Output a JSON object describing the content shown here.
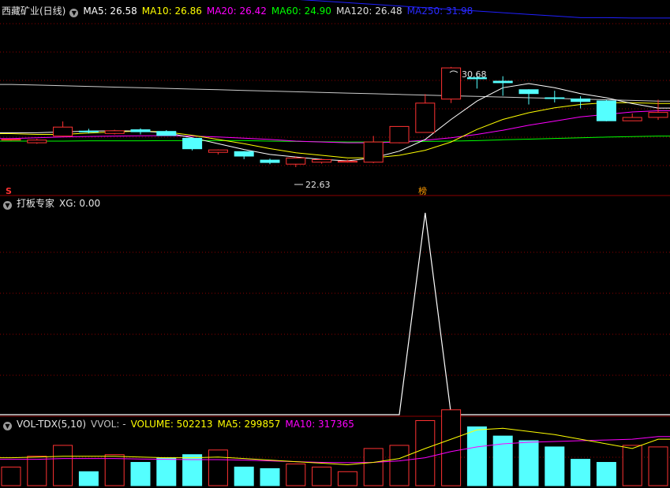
{
  "colors": {
    "up": "#ff3232",
    "down": "#54ffff",
    "ma5": "#ffffff",
    "ma10": "#ffff00",
    "ma20": "#ff00ff",
    "ma60": "#00ff00",
    "ma120": "#cccccc",
    "ma250": "#2020ff",
    "grid": "#8b0000",
    "divider": "#8b0000"
  },
  "main_header": {
    "stock_title": "西藏矿业(日线)",
    "items": [
      {
        "label": "MA5: 26.58",
        "color": "#ffffff"
      },
      {
        "label": "MA10: 26.86",
        "color": "#ffff00"
      },
      {
        "label": "MA20: 26.42",
        "color": "#ff00ff"
      },
      {
        "label": "MA60: 24.90",
        "color": "#00ff00"
      },
      {
        "label": "MA120: 26.48",
        "color": "#dddddd"
      },
      {
        "label": "MA250: 31.98",
        "color": "#2a2aff"
      }
    ]
  },
  "indicator_header": {
    "title": "打板专家",
    "value": "XG: 0.00"
  },
  "volume_header": {
    "title": "VOL-TDX(5,10)",
    "items": [
      {
        "label": "VVOL: -",
        "color": "#c0c0c0"
      },
      {
        "label": "VOLUME: 502213",
        "color": "#ffff00"
      },
      {
        "label": "MA5: 299857",
        "color": "#ffff00"
      },
      {
        "label": "MA10: 317365",
        "color": "#ff00ff"
      }
    ]
  },
  "annotations": {
    "high_label": "30.68",
    "low_label": "22.63",
    "s_marker": "S",
    "rank_marker": "榜"
  },
  "chart_data": [
    {
      "type": "candlestick",
      "title": "西藏矿业(日线)",
      "y_range": [
        22.0,
        31.0
      ],
      "candles": [
        {
          "o": 24.68,
          "c": 24.71,
          "h": 24.74,
          "l": 24.63
        },
        {
          "o": 24.5,
          "c": 24.66,
          "h": 24.74,
          "l": 24.44
        },
        {
          "o": 24.9,
          "c": 25.44,
          "h": 25.78,
          "l": 24.87
        },
        {
          "o": 25.2,
          "c": 25.16,
          "h": 25.34,
          "l": 25.06
        },
        {
          "o": 25.06,
          "c": 25.22,
          "h": 25.28,
          "l": 25.0
        },
        {
          "o": 25.28,
          "c": 25.16,
          "h": 25.37,
          "l": 25.0
        },
        {
          "o": 25.18,
          "c": 24.94,
          "h": 25.26,
          "l": 24.94
        },
        {
          "o": 24.77,
          "c": 24.14,
          "h": 24.77,
          "l": 24.04
        },
        {
          "o": 23.93,
          "c": 24.07,
          "h": 24.1,
          "l": 23.8
        },
        {
          "o": 23.97,
          "c": 23.7,
          "h": 24.0,
          "l": 23.52
        },
        {
          "o": 23.46,
          "c": 23.32,
          "h": 23.55,
          "l": 23.22
        },
        {
          "o": 23.22,
          "c": 23.59,
          "h": 23.69,
          "l": 23.04
        },
        {
          "o": 23.34,
          "c": 23.49,
          "h": 23.55,
          "l": 23.25
        },
        {
          "o": 23.34,
          "c": 23.4,
          "h": 23.49,
          "l": 23.31
        },
        {
          "o": 23.34,
          "c": 24.55,
          "h": 24.91,
          "l": 23.28
        },
        {
          "o": 24.5,
          "c": 25.48,
          "h": 25.48,
          "l": 24.47
        },
        {
          "o": 25.12,
          "c": 26.88,
          "h": 27.42,
          "l": 25.1
        },
        {
          "o": 27.12,
          "c": 28.99,
          "h": 29.05,
          "l": 26.88
        },
        {
          "o": 28.4,
          "c": 28.34,
          "h": 28.65,
          "l": 27.75
        },
        {
          "o": 28.19,
          "c": 28.1,
          "h": 28.49,
          "l": 27.32
        },
        {
          "o": 27.68,
          "c": 27.45,
          "h": 27.71,
          "l": 26.8
        },
        {
          "o": 27.2,
          "c": 27.17,
          "h": 27.62,
          "l": 26.92
        },
        {
          "o": 27.13,
          "c": 26.98,
          "h": 27.29,
          "l": 26.56
        },
        {
          "o": 27.01,
          "c": 25.82,
          "h": 27.08,
          "l": 25.79
        },
        {
          "o": 25.82,
          "c": 26.02,
          "h": 26.26,
          "l": 25.82
        },
        {
          "o": 26.02,
          "c": 26.32,
          "h": 27.09,
          "l": 25.87
        }
      ],
      "ma5": [
        25.1,
        25.1,
        25.15,
        25.2,
        25.22,
        25.2,
        25.1,
        24.8,
        24.45,
        24.1,
        23.8,
        23.65,
        23.5,
        23.42,
        23.6,
        24.0,
        24.7,
        25.9,
        27.0,
        27.8,
        28.05,
        27.8,
        27.45,
        27.2,
        26.85,
        26.58
      ],
      "ma10": [
        25.05,
        25.0,
        25.0,
        25.08,
        25.15,
        25.2,
        25.15,
        24.95,
        24.7,
        24.45,
        24.15,
        23.9,
        23.75,
        23.6,
        23.6,
        23.75,
        24.05,
        24.55,
        25.3,
        25.9,
        26.3,
        26.6,
        26.8,
        26.9,
        26.9,
        26.86
      ],
      "ma20": [
        24.75,
        24.8,
        24.85,
        24.88,
        24.9,
        24.92,
        24.93,
        24.9,
        24.85,
        24.78,
        24.7,
        24.6,
        24.55,
        24.5,
        24.5,
        24.55,
        24.65,
        24.8,
        25.0,
        25.25,
        25.55,
        25.8,
        26.05,
        26.2,
        26.35,
        26.42
      ],
      "ma60": [
        24.6,
        24.6,
        24.6,
        24.62,
        24.62,
        24.62,
        24.63,
        24.63,
        24.63,
        24.63,
        24.6,
        24.58,
        24.56,
        24.55,
        24.55,
        24.56,
        24.58,
        24.6,
        24.63,
        24.68,
        24.72,
        24.76,
        24.8,
        24.84,
        24.87,
        24.9
      ],
      "ma120": [
        28.0,
        27.96,
        27.92,
        27.88,
        27.84,
        27.8,
        27.76,
        27.72,
        27.68,
        27.64,
        27.6,
        27.56,
        27.52,
        27.48,
        27.44,
        27.4,
        27.36,
        27.32,
        27.28,
        27.24,
        27.2,
        27.16,
        27.12,
        27.08,
        27.04,
        27.0
      ],
      "ma250": [
        34.2,
        34.1,
        34.0,
        33.9,
        33.8,
        33.7,
        33.6,
        33.5,
        33.4,
        33.3,
        33.2,
        33.1,
        33.0,
        32.9,
        32.8,
        32.7,
        32.6,
        32.5,
        32.4,
        32.3,
        32.2,
        32.1,
        32.0,
        32.0,
        31.98,
        31.98
      ]
    },
    {
      "type": "line",
      "title": "打板专家",
      "series": [
        {
          "name": "XG",
          "values": [
            0,
            0,
            0,
            0,
            0,
            0,
            0,
            0,
            0,
            0,
            0,
            0,
            0,
            0,
            0,
            0,
            1,
            0,
            0,
            0,
            0,
            0,
            0,
            0,
            0,
            0
          ]
        }
      ],
      "ylim": [
        0,
        1
      ]
    },
    {
      "type": "bar",
      "title": "VOL-TDX(5,10)",
      "volume": [
        120000,
        190000,
        260000,
        90000,
        200000,
        150000,
        180000,
        200000,
        230000,
        120000,
        110000,
        140000,
        120000,
        90000,
        240000,
        260000,
        420000,
        490000,
        380000,
        320000,
        290000,
        250000,
        170000,
        150000,
        260000,
        250000
      ],
      "vol_ma5": [
        180000,
        185000,
        190000,
        190000,
        190000,
        185000,
        180000,
        180000,
        185000,
        175000,
        165000,
        155000,
        145000,
        135000,
        150000,
        175000,
        240000,
        300000,
        360000,
        370000,
        350000,
        330000,
        300000,
        270000,
        240000,
        299857
      ],
      "vol_ma10": [
        170000,
        170000,
        175000,
        175000,
        175000,
        172000,
        170000,
        168000,
        168000,
        165000,
        160000,
        155000,
        150000,
        148000,
        150000,
        160000,
        180000,
        220000,
        250000,
        270000,
        280000,
        285000,
        290000,
        295000,
        300000,
        317365
      ],
      "ylim": [
        0,
        560000
      ]
    }
  ]
}
